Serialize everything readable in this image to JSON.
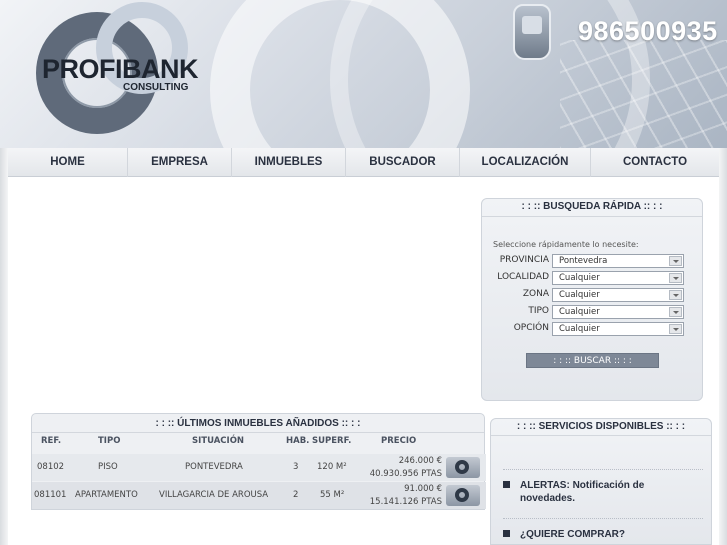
{
  "header": {
    "brand": "PROFIBANK",
    "brand_sub": "CONSULTING",
    "phone": "986500935"
  },
  "nav": {
    "items": [
      "HOME",
      "EMPRESA",
      "INMUEBLES",
      "BUSCADOR",
      "LOCALIZACIÓN",
      "CONTACTO"
    ]
  },
  "search": {
    "title": ": : :: BUSQUEDA RÁPIDA :: : :",
    "hint": "Seleccione rápidamente lo necesite:",
    "fields": [
      {
        "label": "PROVINCIA",
        "value": "Pontevedra"
      },
      {
        "label": "LOCALIDAD",
        "value": "Cualquier"
      },
      {
        "label": "ZONA",
        "value": "Cualquier"
      },
      {
        "label": "TIPO",
        "value": "Cualquier"
      },
      {
        "label": "OPCIÓN",
        "value": "Cualquier"
      }
    ],
    "button": ": : :: BUSCAR :: : :"
  },
  "latest": {
    "title": ": : :: ÚLTIMOS INMUEBLES AÑADIDOS :: : :",
    "headers": {
      "ref": "REF.",
      "tipo": "TIPO",
      "situacion": "SITUACIÓN",
      "hab": "HAB.",
      "superf": "SUPERF.",
      "precio": "PRECIO"
    },
    "rows": [
      {
        "ref": "08102",
        "tipo": "PISO",
        "situacion": "PONTEVEDRA",
        "hab": "3",
        "superf": "120 M²",
        "precio_eur": "246.000 €",
        "precio_ptas": "40.930.956 PTAS"
      },
      {
        "ref": "081101",
        "tipo": "APARTAMENTO",
        "situacion": "VILLAGARCIA DE AROUSA",
        "hab": "2",
        "superf": "55 M²",
        "precio_eur": "91.000 €",
        "precio_ptas": "15.141.126 PTAS"
      }
    ]
  },
  "services": {
    "title": ": : :: SERVICIOS DISPONIBLES :: : :",
    "items": [
      "ALERTAS: Notificación de novedades.",
      "¿QUIERE COMPRAR?"
    ]
  }
}
